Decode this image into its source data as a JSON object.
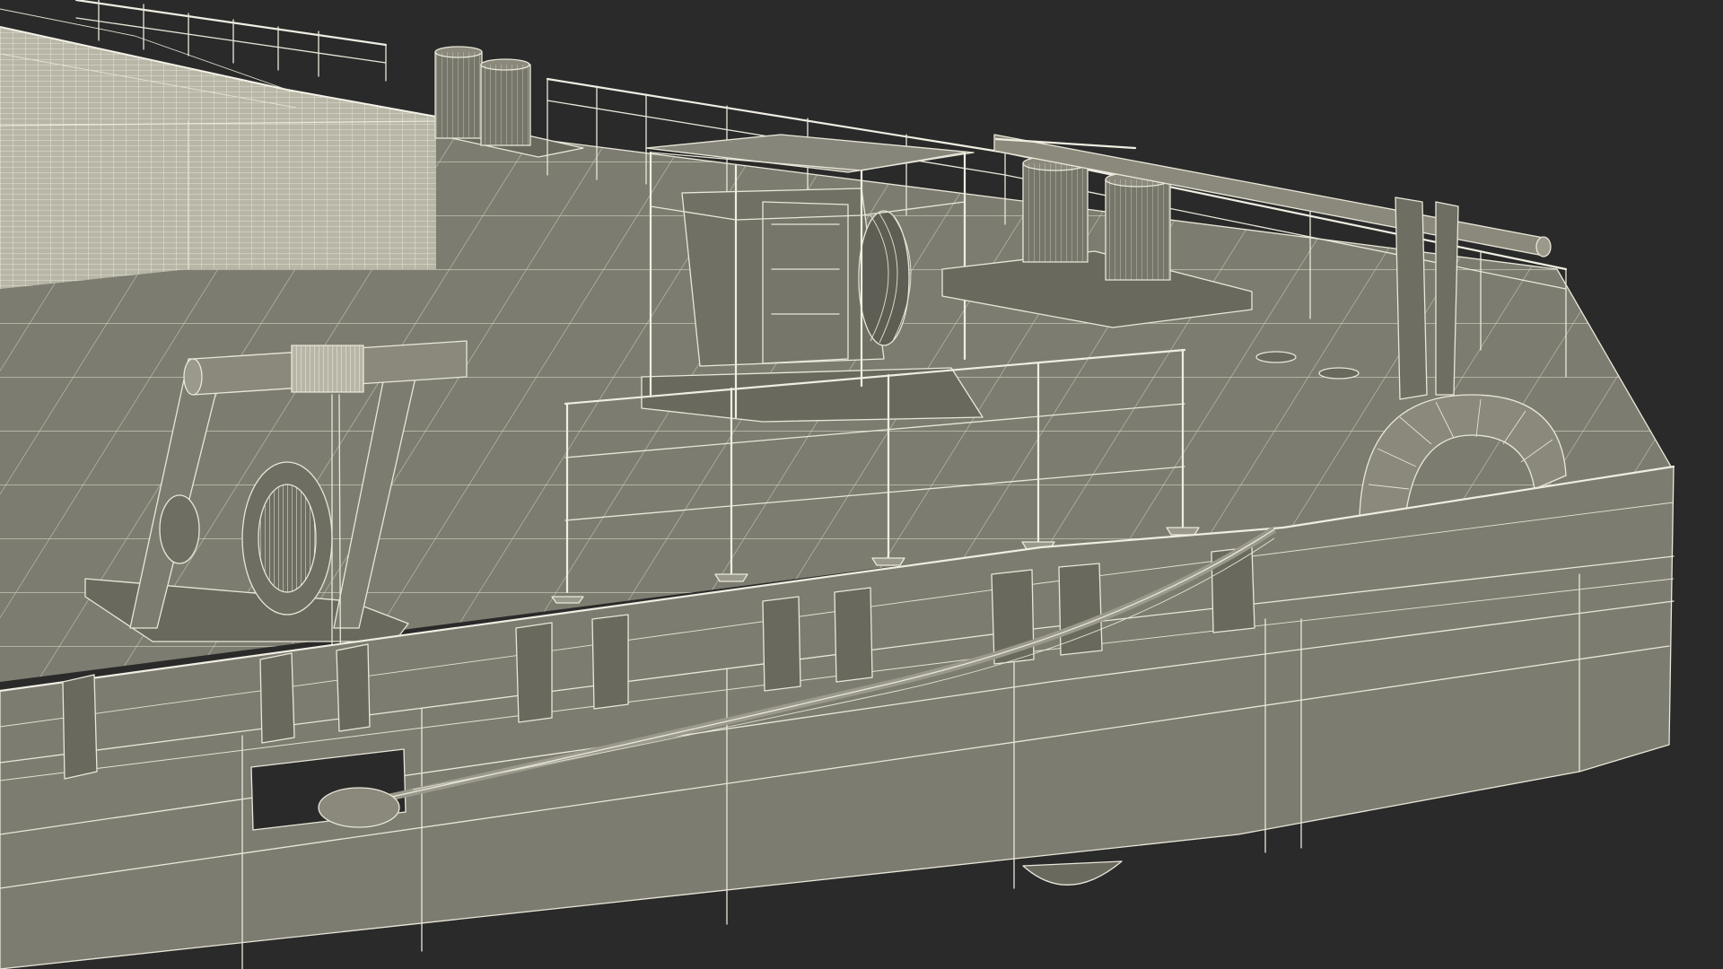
{
  "scene": {
    "background_color": "#2a2a2a",
    "model_fill_color": "#7d7c70",
    "model_dark_fill_color": "#6a695e",
    "wireframe_color": "#e9e7d9",
    "elements": [
      "deck-plate-stack",
      "bollard-pair-aft",
      "bollard-pair-forward",
      "skid-frame-unit",
      "crane-winch",
      "life-ring-fender",
      "guard-rail",
      "tow-cable",
      "hull"
    ]
  }
}
